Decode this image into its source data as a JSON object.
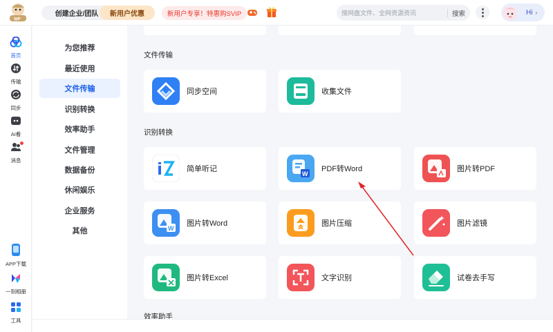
{
  "header": {
    "create_team": "创建企业/团队",
    "new_user_offer": "新用户优惠",
    "promo": "新用户专享！特惠购SVIP",
    "search_placeholder": "搜网盘文件、全网资源资讯",
    "search_button": "搜索",
    "profile_greeting": "Hi",
    "logo_badge": "WP"
  },
  "left_nav": {
    "items": [
      {
        "label": "首页",
        "icon": "home-icon"
      },
      {
        "label": "传输",
        "icon": "transfer-icon"
      },
      {
        "label": "同步",
        "icon": "sync-icon"
      },
      {
        "label": "AI看",
        "icon": "ai-icon"
      },
      {
        "label": "消息",
        "icon": "message-icon"
      }
    ],
    "bottom_items": [
      {
        "label": "APP下载",
        "icon": "phone-icon"
      },
      {
        "label": "一刻相册",
        "icon": "album-icon"
      },
      {
        "label": "工具",
        "icon": "tools-icon"
      }
    ]
  },
  "side_nav": {
    "items": [
      "为您推荐",
      "最近使用",
      "文件传输",
      "识别转换",
      "效率助手",
      "文件管理",
      "数据备份",
      "休闲娱乐",
      "企业服务",
      "其他"
    ],
    "active_index": 2
  },
  "sections": {
    "file_transfer": {
      "title": "文件传输",
      "cards": [
        {
          "label": "同步空间",
          "icon": "sync-space-icon"
        },
        {
          "label": "收集文件",
          "icon": "collect-file-icon"
        }
      ]
    },
    "recognition": {
      "title": "识别转换",
      "cards": [
        {
          "label": "简单听记",
          "icon": "note-icon"
        },
        {
          "label": "PDF转Word",
          "icon": "pdf-to-word-icon"
        },
        {
          "label": "图片转PDF",
          "icon": "image-to-pdf-icon"
        },
        {
          "label": "图片转Word",
          "icon": "image-to-word-icon"
        },
        {
          "label": "图片压缩",
          "icon": "image-compress-icon"
        },
        {
          "label": "图片滤镜",
          "icon": "image-filter-icon"
        },
        {
          "label": "图片转Excel",
          "icon": "image-to-excel-icon"
        },
        {
          "label": "文字识别",
          "icon": "ocr-icon"
        },
        {
          "label": "试卷去手写",
          "icon": "erase-handwriting-icon"
        }
      ]
    },
    "efficiency": {
      "title": "效率助手"
    }
  },
  "colors": {
    "accent": "#1f62e8",
    "annotation_arrow": "#e0262b"
  }
}
